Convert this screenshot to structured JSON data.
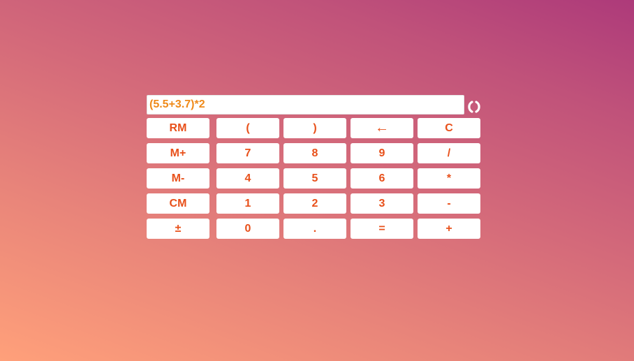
{
  "display": {
    "value": "(5.5+3.7)*2"
  },
  "refresh": {
    "icon": "refresh-icon"
  },
  "keys": [
    {
      "label": "RM"
    },
    {
      "label": "("
    },
    {
      "label": ")"
    },
    {
      "label": "←"
    },
    {
      "label": "C"
    },
    {
      "label": "M+"
    },
    {
      "label": "7"
    },
    {
      "label": "8"
    },
    {
      "label": "9"
    },
    {
      "label": "/"
    },
    {
      "label": "M-"
    },
    {
      "label": "4"
    },
    {
      "label": "5"
    },
    {
      "label": "6"
    },
    {
      "label": "*"
    },
    {
      "label": "CM"
    },
    {
      "label": "1"
    },
    {
      "label": "2"
    },
    {
      "label": "3"
    },
    {
      "label": "-"
    },
    {
      "label": "±"
    },
    {
      "label": "0"
    },
    {
      "label": "."
    },
    {
      "label": "="
    },
    {
      "label": "+"
    }
  ],
  "colors": {
    "key_text": "#e8501a",
    "display_text": "#ef8a1a",
    "key_background": "#ffffff"
  }
}
